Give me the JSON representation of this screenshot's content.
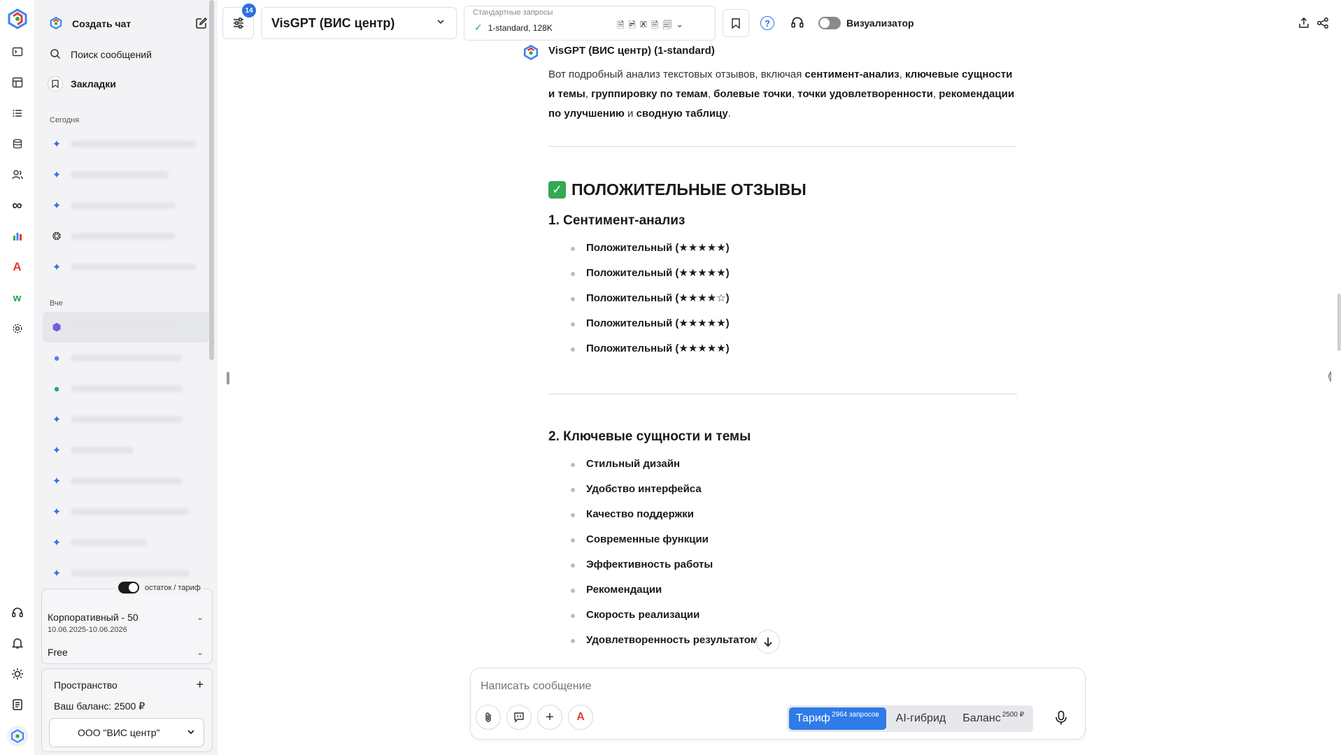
{
  "sidebar": {
    "new_chat_label": "Создать чат",
    "search_label": "Поиск сообщений",
    "bookmarks_label": "Закладки",
    "section_today": "Сегодня",
    "section_yesterday": "Вче",
    "plan_toggle_label": "остаток / тариф",
    "plan_name": "Корпоративный - 50",
    "plan_dates": "10.06.2025-10.06.2026",
    "plan_tier": "Free",
    "space_label": "Пространство",
    "balance_label": "Ваш баланс: 2500 ₽",
    "org_name": "ООО \"ВИС центр\""
  },
  "topbar": {
    "badge_count": "14",
    "model_name": "VisGPT (ВИС центр)",
    "requests_label": "Стандартные запросы",
    "requests_value": "1-standard, 128K",
    "visualizer_label": "Визуализатор"
  },
  "response": {
    "title": "VisGPT (ВИС центр) (1-standard)",
    "intro_1": "Вот подробный анализ текстовых отзывов, включая ",
    "intro_b1": "сентимент-анализ",
    "intro_2": ", ",
    "intro_b2": "ключевые сущности и темы",
    "intro_3": ", ",
    "intro_b3": "группировку по темам",
    "intro_4": ", ",
    "intro_b4": "болевые точки",
    "intro_5": ", ",
    "intro_b5": "точки удовлетворенности",
    "intro_6": ", ",
    "intro_b6": "рекомендации по улучшению",
    "intro_7": " и ",
    "intro_b7": "сводную таблицу",
    "intro_8": ".",
    "section_heading": "ПОЛОЖИТЕЛЬНЫЕ ОТЗЫВЫ",
    "sub1": "1. Сентимент-анализ",
    "sentiments": [
      "Положительный (★★★★★)",
      "Положительный (★★★★★)",
      "Положительный (★★★★☆)",
      "Положительный (★★★★★)",
      "Положительный (★★★★★)"
    ],
    "sub2": "2. Ключевые сущности и темы",
    "themes": [
      "Стильный дизайн",
      "Удобство интерфейса",
      "Качество поддержки",
      "Современные функции",
      "Эффективность работы",
      "Рекомендации",
      "Скорость реализации",
      "Удовлетворенность результатом"
    ]
  },
  "composer": {
    "placeholder": "Написать сообщение",
    "mode_tariff": "Тариф",
    "mode_tariff_sup": "2964 запросов",
    "mode_hybrid": "AI-гибрид",
    "mode_balance": "Баланс",
    "mode_balance_sup": "2500 ₽"
  },
  "colors": {
    "accent": "#2f7be8",
    "badge": "#2f6fe4",
    "check_green": "#34a853",
    "sidebar_bg": "#f3f3f5"
  }
}
